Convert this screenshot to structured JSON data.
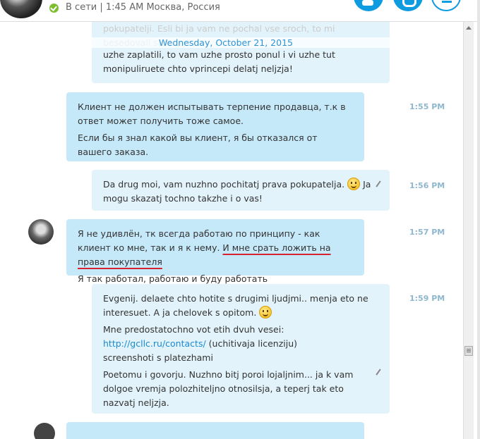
{
  "header": {
    "status": "В сети",
    "time_location": "1:45 AM Москва, Россия"
  },
  "chat": {
    "date_separator": "Wednesday, October 21, 2015",
    "partial_top": {
      "ghost_lines": [
        "pokupatelji. Esli bi ja vam ne pochal vse sroch, to mi",
        "besedovali slab..."
      ],
      "lines": [
        "uzhe zaplatili, to vam uzhe prosto ponul i vi uzhe tut",
        "monipuliruete chto vprincepi delatj neljzja!"
      ]
    },
    "messages": [
      {
        "time": "1:55 PM",
        "paragraphs": [
          "Клиент не должен испытывать терпение продавца, т.к в ответ может получить тоже самое.",
          "Если бы я знал какой вы клиент, я бы отказался от вашего заказа."
        ]
      },
      {
        "time": "1:56 PM",
        "text_before": "Da drug moi, vam nuzhno pochitatj prava pokupatelja.",
        "text_after": "Ja mogu skazatj tochno takzhe i o vas!"
      },
      {
        "time": "1:57 PM",
        "text_plain": "Я не удивлён, тк всегда работаю по принципу - как клиент ко мне, так и я к нему.",
        "text_underlined": "И мне срать ложить на права покупателя",
        "text_second": "Я так работал, работаю и буду работать"
      },
      {
        "time": "1:59 PM",
        "p1": "Evgenij. delaete chto hotite s drugimi ljudjmi.. menja eto ne interesuet. A ja chelovek s opitom.",
        "p2_line1": "Mne predostatochno vot etih dvuh vesei:",
        "p2_link": "http://gcllc.ru/contacts/",
        "p2_link_suffix": "(uchitivaja licenziju)",
        "p2_line3": "screenshoti s platezhami",
        "p3": "Poetomu i govorju. Nuzhno bitj poroi lojaljnim... ja k vam dolgoe vremja polozhiteljno otnosilsja, a teperj tak eto nazvatj neljzja."
      }
    ]
  },
  "colors": {
    "accent": "#0e9be0",
    "incoming_bubble": "#c6e9fa",
    "outgoing_bubble": "#e3f3fb",
    "timestamp": "#8fb6cf",
    "underline": "#d7232f"
  }
}
